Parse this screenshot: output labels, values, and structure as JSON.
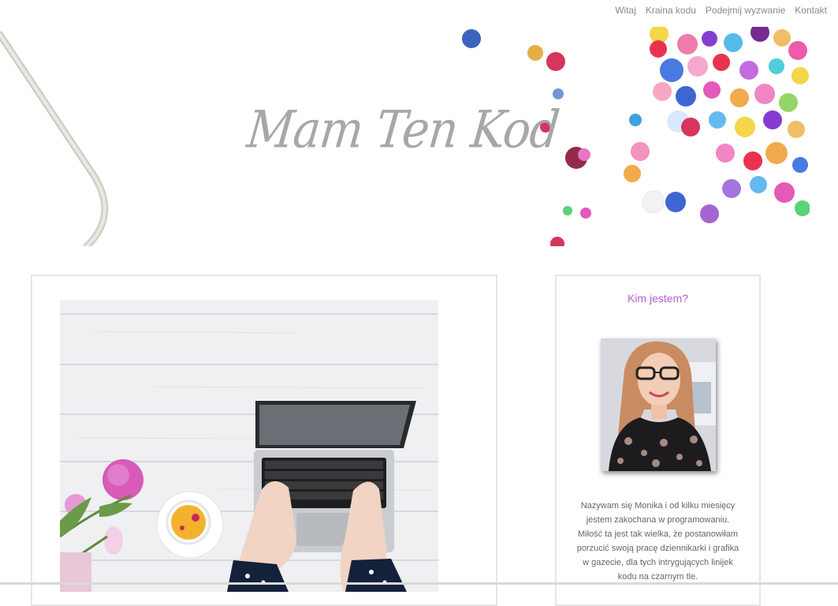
{
  "nav": {
    "items": [
      "Witaj",
      "Kraina kodu",
      "Podejmij wyzwanie",
      "Kontakt"
    ]
  },
  "hero": {
    "title": "Mam Ten Kod"
  },
  "sidebar": {
    "title": "Kim jestem?",
    "bio": "Nazywam się Monika i od kilku miesięcy jestem zakochana w programowaniu. Miłość ta jest tak wielka, że postanowiłam porzucić swoją pracę dziennikarki i grafika w gazecie, dla tych intrygujących linijek kodu na czarnym tle."
  },
  "colors": {
    "accent": "#b65ed1",
    "nav_text": "#8a8a8a",
    "hero_title": "#a7a7aa"
  }
}
